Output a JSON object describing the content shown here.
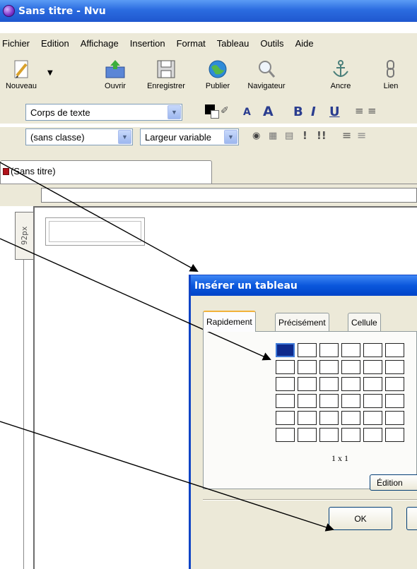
{
  "window": {
    "title": "Sans titre - Nvu"
  },
  "menu": [
    {
      "label": "Fichier"
    },
    {
      "label": "Edition"
    },
    {
      "label": "Affichage"
    },
    {
      "label": "Insertion"
    },
    {
      "label": "Format"
    },
    {
      "label": "Tableau"
    },
    {
      "label": "Outils"
    },
    {
      "label": "Aide"
    }
  ],
  "toolbar": {
    "buttons": [
      {
        "label": "Nouveau",
        "icon": "pencil-document-icon"
      },
      {
        "label": "Ouvrir",
        "icon": "open-folder-icon"
      },
      {
        "label": "Enregistrer",
        "icon": "floppy-icon"
      },
      {
        "label": "Publier",
        "icon": "globe-icon"
      },
      {
        "label": "Navigateur",
        "icon": "magnifier-icon"
      },
      {
        "label": "Ancre",
        "icon": "anchor-icon"
      },
      {
        "label": "Lien",
        "icon": "chain-link-icon"
      }
    ]
  },
  "format_bar": {
    "paragraph_style": "Corps de texte",
    "class_select": "(sans classe)",
    "width_select": "Largeur variable",
    "bold": "B",
    "italic": "I",
    "underline": "U"
  },
  "document": {
    "tab_label": "(Sans titre)",
    "ruler_label": "92px"
  },
  "dialog": {
    "title": "Insérer un tableau",
    "tabs": [
      {
        "label": "Rapidement"
      },
      {
        "label": "Précisément"
      },
      {
        "label": "Cellule"
      }
    ],
    "size_label": "1 x 1",
    "edit_button": "Édition",
    "ok_button": "OK"
  },
  "colors": {
    "titlebar": "#2b6ce0",
    "chrome": "#ece9d8",
    "selection": "#0e2a8c"
  }
}
